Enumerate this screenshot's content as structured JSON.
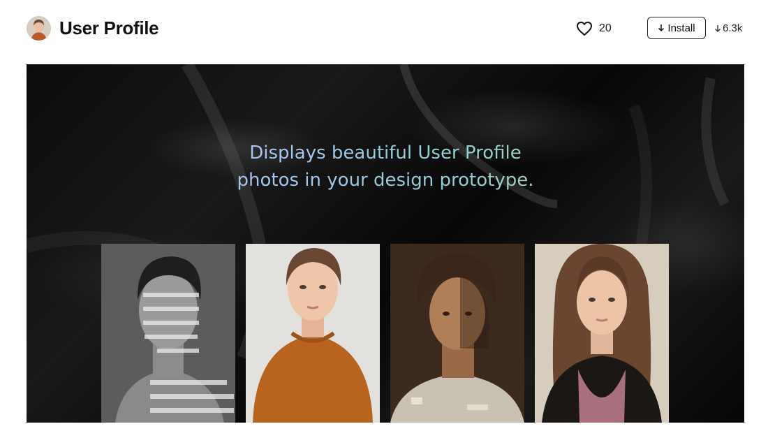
{
  "header": {
    "title": "User Profile",
    "like_count": "20",
    "install_label": "Install",
    "downloads": "6.3k"
  },
  "hero": {
    "tagline_line1": "Displays beautiful User Profile",
    "tagline_line2": "photos in your design prototype."
  },
  "colors": {
    "accent_gradient": [
      "#c6b8ea",
      "#a6c6ef",
      "#8fd0d0",
      "#d6cf8e"
    ],
    "hero_background": "#0c0c0c"
  },
  "icons": [
    "heart-icon",
    "arrow-down-icon"
  ]
}
